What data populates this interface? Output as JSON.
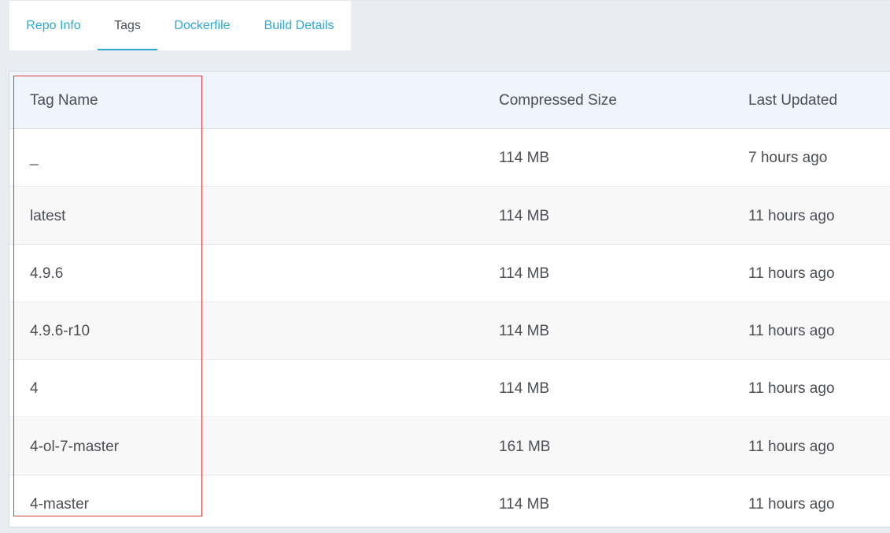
{
  "tabs": [
    {
      "label": "Repo Info"
    },
    {
      "label": "Tags"
    },
    {
      "label": "Dockerfile"
    },
    {
      "label": "Build Details"
    }
  ],
  "active_tab": "Tags",
  "table": {
    "headers": {
      "name": "Tag Name",
      "size": "Compressed Size",
      "updated": "Last Updated"
    },
    "rows": [
      {
        "name": "_",
        "size": "114 MB",
        "updated": "7 hours ago"
      },
      {
        "name": "latest",
        "size": "114 MB",
        "updated": "11 hours ago"
      },
      {
        "name": "4.9.6",
        "size": "114 MB",
        "updated": "11 hours ago"
      },
      {
        "name": "4.9.6-r10",
        "size": "114 MB",
        "updated": "11 hours ago"
      },
      {
        "name": "4",
        "size": "114 MB",
        "updated": "11 hours ago"
      },
      {
        "name": "4-ol-7-master",
        "size": "161 MB",
        "updated": "11 hours ago"
      },
      {
        "name": "4-master",
        "size": "114 MB",
        "updated": "11 hours ago"
      }
    ]
  },
  "colors": {
    "accent": "#2ca9d8",
    "annotation_box": "#d63a3a",
    "header_bg": "#eff5fc"
  }
}
